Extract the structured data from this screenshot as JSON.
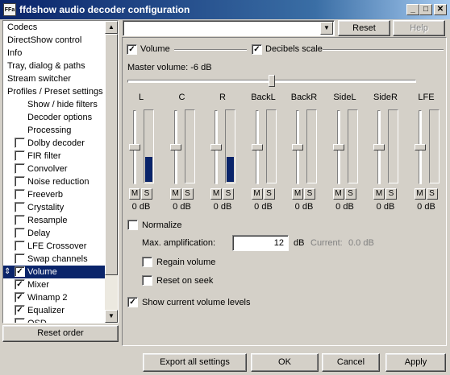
{
  "window": {
    "title": "ffdshow audio decoder configuration",
    "app_icon": "FFa",
    "minimize": "_",
    "maximize": "□",
    "close": "✕"
  },
  "sidebar": {
    "items": [
      {
        "label": "Codecs",
        "checkbox": null,
        "indent": false
      },
      {
        "label": "DirectShow control",
        "checkbox": null,
        "indent": false
      },
      {
        "label": "Info",
        "checkbox": null,
        "indent": false
      },
      {
        "label": "Tray, dialog & paths",
        "checkbox": null,
        "indent": false
      },
      {
        "label": "Stream switcher",
        "checkbox": null,
        "indent": false
      },
      {
        "label": "Profiles / Preset settings",
        "checkbox": null,
        "indent": false
      },
      {
        "label": "Show / hide filters",
        "checkbox": null,
        "indent": true
      },
      {
        "label": "Decoder options",
        "checkbox": null,
        "indent": true
      },
      {
        "label": "Processing",
        "checkbox": null,
        "indent": true
      },
      {
        "label": "Dolby decoder",
        "checkbox": false,
        "indent": false
      },
      {
        "label": "FIR filter",
        "checkbox": false,
        "indent": false
      },
      {
        "label": "Convolver",
        "checkbox": false,
        "indent": false
      },
      {
        "label": "Noise reduction",
        "checkbox": false,
        "indent": false
      },
      {
        "label": "Freeverb",
        "checkbox": false,
        "indent": false
      },
      {
        "label": "Crystality",
        "checkbox": false,
        "indent": false
      },
      {
        "label": "Resample",
        "checkbox": false,
        "indent": false
      },
      {
        "label": "Delay",
        "checkbox": false,
        "indent": false
      },
      {
        "label": "LFE Crossover",
        "checkbox": false,
        "indent": false
      },
      {
        "label": "Swap channels",
        "checkbox": false,
        "indent": false
      },
      {
        "label": "Volume",
        "checkbox": true,
        "indent": false,
        "selected": true
      },
      {
        "label": "Mixer",
        "checkbox": true,
        "indent": false
      },
      {
        "label": "Winamp 2",
        "checkbox": true,
        "indent": false
      },
      {
        "label": "Equalizer",
        "checkbox": true,
        "indent": false
      },
      {
        "label": "OSD",
        "checkbox": false,
        "indent": false
      }
    ],
    "reset_order": "Reset order"
  },
  "preset": {
    "value": "",
    "reset": "Reset",
    "help": "Help"
  },
  "volume": {
    "enable_label": "Volume",
    "enable_checked": true,
    "db_scale_label": "Decibels scale",
    "db_scale_checked": true,
    "master_label": "Master volume: -6 dB",
    "master_level": 0.5,
    "channels": [
      {
        "name": "L",
        "value": "0 dB",
        "level": 0.35
      },
      {
        "name": "C",
        "value": "0 dB",
        "level": 0.0
      },
      {
        "name": "R",
        "value": "0 dB",
        "level": 0.35
      },
      {
        "name": "BackL",
        "value": "0 dB",
        "level": 0.0
      },
      {
        "name": "BackR",
        "value": "0 dB",
        "level": 0.0
      },
      {
        "name": "SideL",
        "value": "0 dB",
        "level": 0.0
      },
      {
        "name": "SideR",
        "value": "0 dB",
        "level": 0.0
      },
      {
        "name": "LFE",
        "value": "0 dB",
        "level": 0.0
      }
    ],
    "mute_label": "M",
    "solo_label": "S",
    "normalize_label": "Normalize",
    "max_amp_label": "Max. amplification:",
    "max_amp_value": "12",
    "max_amp_unit": "dB",
    "current_label": "Current:",
    "current_value": "0.0 dB",
    "regain_label": "Regain volume",
    "reset_seek_label": "Reset on seek",
    "show_levels_label": "Show current volume levels",
    "show_levels_checked": true
  },
  "footer": {
    "export": "Export all settings",
    "ok": "OK",
    "cancel": "Cancel",
    "apply": "Apply"
  },
  "colors": {
    "titlebar_start": "#0a246a",
    "selection": "#0a246a",
    "level_meter": "#0a246a",
    "face": "#d4d0c8"
  }
}
